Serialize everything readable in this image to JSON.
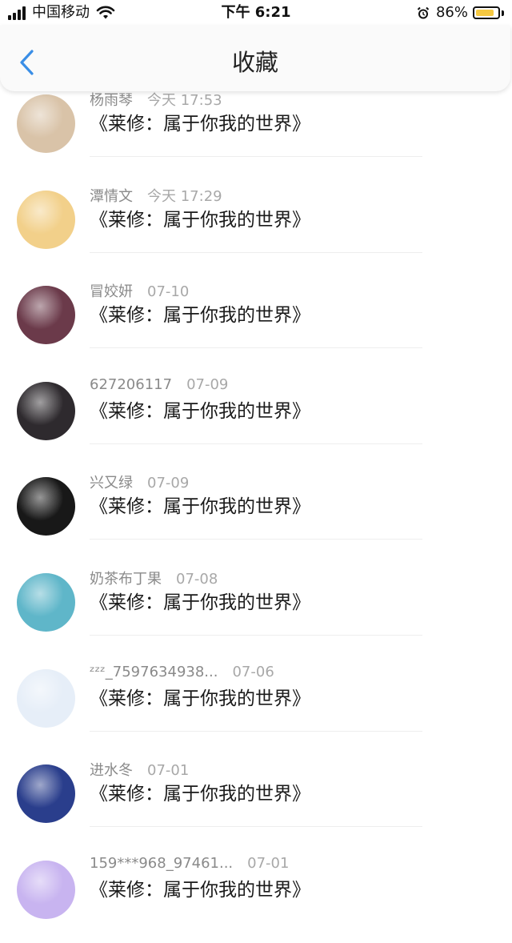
{
  "status_bar": {
    "carrier": "中国移动",
    "time": "下午 6:21",
    "battery_percent": "86%",
    "battery_level": 0.86,
    "battery_color": "#f5c842"
  },
  "nav": {
    "title": "收藏",
    "back_icon": "chevron-left-icon",
    "accent": "#3a8ee6"
  },
  "items": [
    {
      "name": "杨雨琴",
      "date": "今天 17:53",
      "title": "《莱修：属于你我的世界》",
      "avatar_color": "#d9c3a8"
    },
    {
      "name": "潭情文",
      "date": "今天 17:29",
      "title": "《莱修：属于你我的世界》",
      "avatar_color": "#f2d08a"
    },
    {
      "name": "冒姣妍",
      "date": "07-10",
      "title": "《莱修：属于你我的世界》",
      "avatar_color": "#6b3a4a"
    },
    {
      "name": "627206117",
      "date": "07-09",
      "title": "《莱修：属于你我的世界》",
      "avatar_color": "#2e2a2e"
    },
    {
      "name": "兴又绿",
      "date": "07-09",
      "title": "《莱修：属于你我的世界》",
      "avatar_color": "#181818"
    },
    {
      "name": "奶茶布丁果",
      "date": "07-08",
      "title": "《莱修：属于你我的世界》",
      "avatar_color": "#5fb6c9"
    },
    {
      "name": "ᶻᶻᶻ_7597634938...",
      "date": "07-06",
      "title": "《莱修：属于你我的世界》",
      "avatar_color": "#e6eef8"
    },
    {
      "name": "进水冬",
      "date": "07-01",
      "title": "《莱修：属于你我的世界》",
      "avatar_color": "#2a3e8c"
    },
    {
      "name": "159***968_97461...",
      "date": "07-01",
      "title": "《莱修：属于你我的世界》",
      "avatar_color": "#c8b4f0"
    }
  ]
}
